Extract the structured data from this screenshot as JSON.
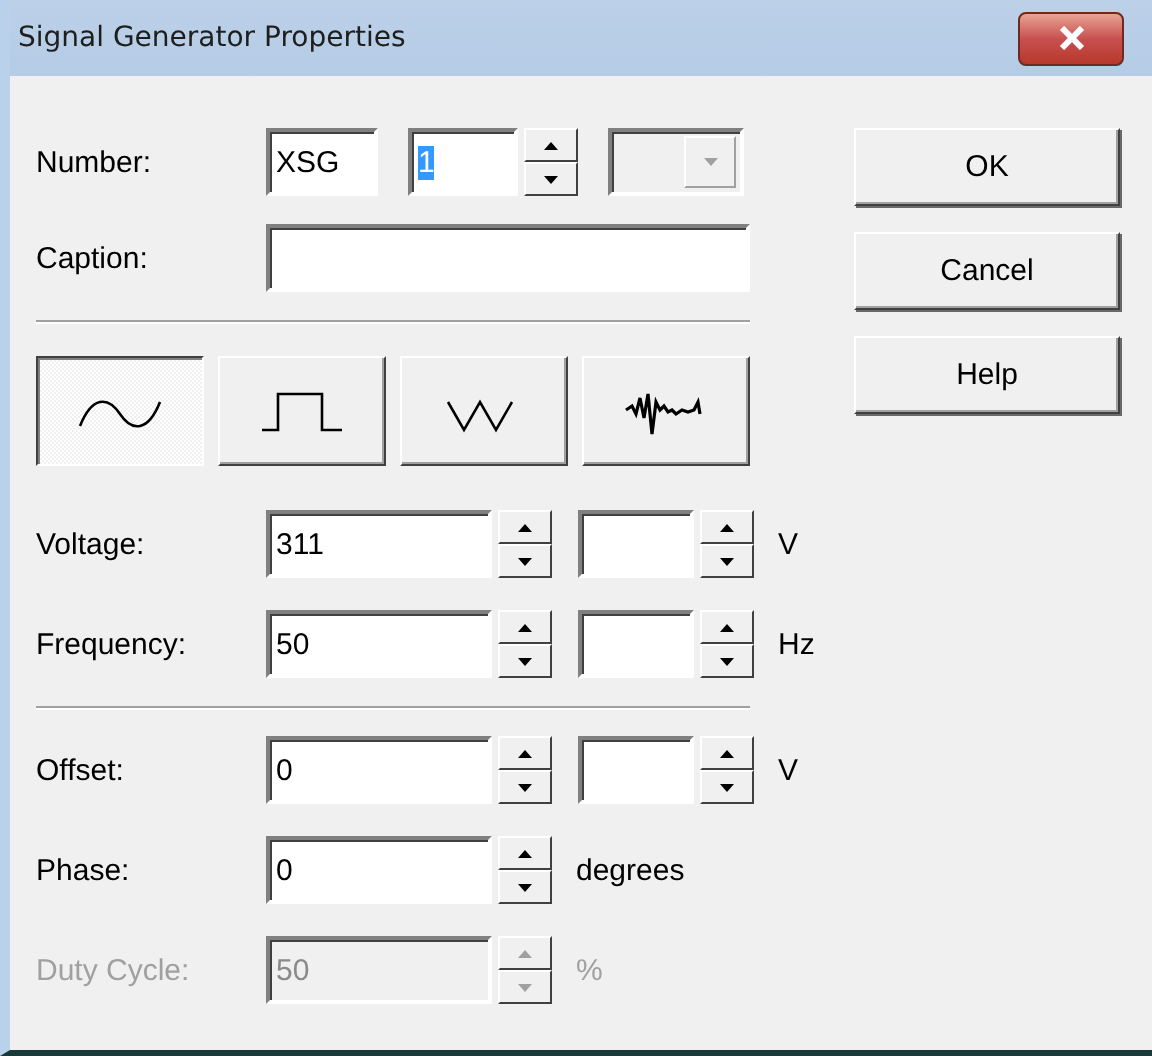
{
  "window": {
    "title": "Signal Generator Properties"
  },
  "number": {
    "label": "Number:",
    "prefix": "XSG",
    "value": "1",
    "value_selected": true,
    "combo_disabled": true
  },
  "caption": {
    "label": "Caption:"
  },
  "waveforms": [
    {
      "kind": "sine",
      "selected": true
    },
    {
      "kind": "square",
      "selected": false
    },
    {
      "kind": "triangle",
      "selected": false
    },
    {
      "kind": "noise",
      "selected": false
    }
  ],
  "groups": [
    [
      {
        "label": "Voltage:",
        "value": "311",
        "secondary_field": true,
        "unit": "V",
        "disabled": false
      },
      {
        "label": "Frequency:",
        "value": "50",
        "secondary_field": true,
        "unit": "Hz",
        "disabled": false
      }
    ],
    [
      {
        "label": "Offset:",
        "value": "0",
        "secondary_field": true,
        "unit": "V",
        "disabled": false
      },
      {
        "label": "Phase:",
        "value": "0",
        "secondary_field": false,
        "unit": "degrees",
        "disabled": false
      },
      {
        "label": "Duty Cycle:",
        "value": "50",
        "secondary_field": false,
        "unit": "%",
        "disabled": true
      }
    ]
  ],
  "buttons": [
    {
      "label": "OK"
    },
    {
      "label": "Cancel"
    },
    {
      "label": "Help"
    }
  ]
}
